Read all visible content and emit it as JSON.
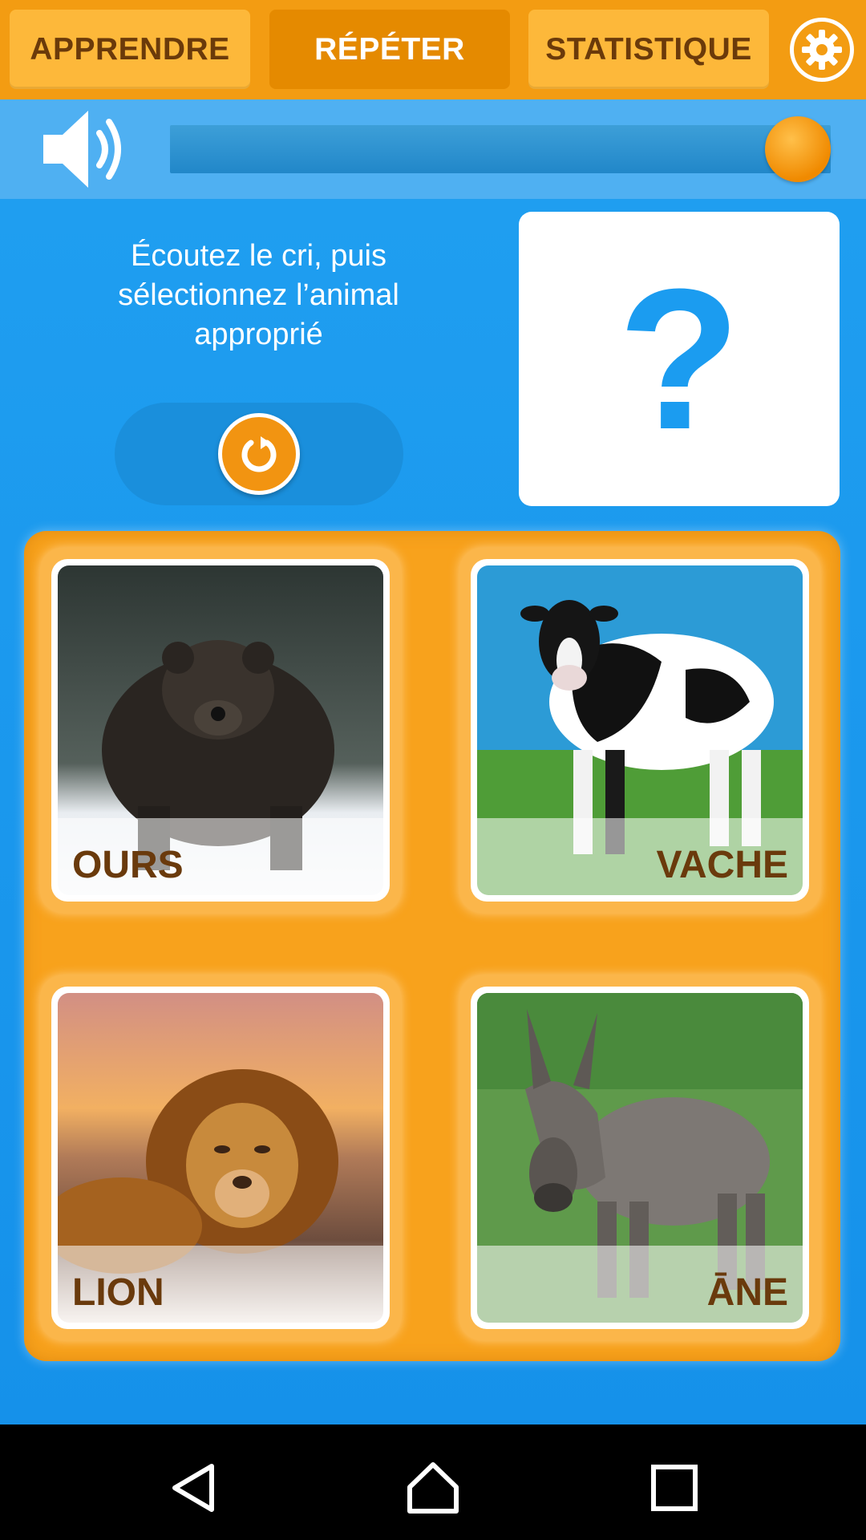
{
  "tabs": [
    {
      "label": "APPRENDRE",
      "active": false
    },
    {
      "label": "RÉPÉTER",
      "active": true
    },
    {
      "label": "STATISTIQUE",
      "active": false
    }
  ],
  "settings": {
    "icon": "gear-icon"
  },
  "audio": {
    "icon": "speaker-icon",
    "progress": 1.0
  },
  "instruction": "Écoutez le cri, puis sélectionnez l’animal approprié",
  "replay": {
    "icon": "replay-icon"
  },
  "answer_card": {
    "symbol": "?"
  },
  "choices": [
    {
      "label": "OURS",
      "image": "bear-photo"
    },
    {
      "label": "VACHE",
      "image": "cow-photo"
    },
    {
      "label": "LION",
      "image": "lion-photo"
    },
    {
      "label": "ĀNE",
      "image": "donkey-photo"
    }
  ],
  "colors": {
    "tab_bar": "#f39c12",
    "active_tab": "#e58a00",
    "inactive_tab": "#fdb83a",
    "label_text": "#6a3a0c",
    "background_blue": "#1b9cf0",
    "panel_orange": "#f8a21c"
  },
  "navbar": {
    "back": "back-icon",
    "home": "home-icon",
    "recents": "recents-icon"
  }
}
